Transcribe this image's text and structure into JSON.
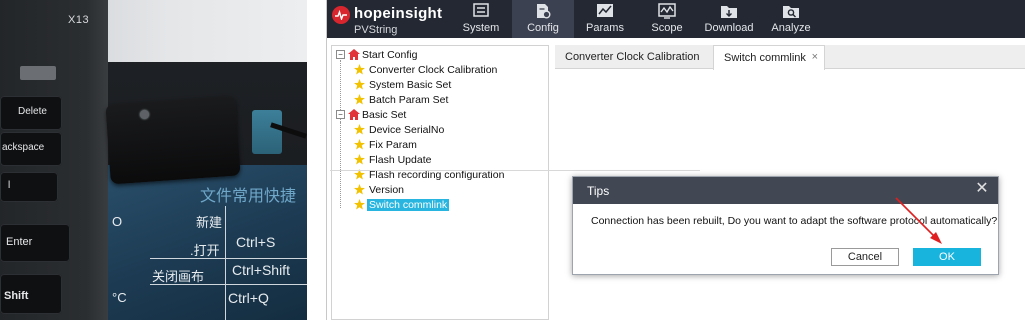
{
  "photo": {
    "laptop_model": "X13",
    "keys": [
      "Delete",
      "ackspace",
      "Enter",
      "Shift",
      "l"
    ],
    "mat_heading": "文件常用快捷",
    "mat_lines": [
      {
        "cn": "新建",
        "key": "Ctrl+S"
      },
      {
        "cn": ".打开",
        "key": "Ctrl+Shift"
      },
      {
        "cn": "关闭画布",
        "key": "Ctrl+Q"
      }
    ],
    "mat_glyphs": [
      "O",
      "°C"
    ]
  },
  "app": {
    "brand": {
      "name": "hopeinsight",
      "subtitle": "PVString",
      "logo_color": "#d9262e"
    },
    "nav": [
      {
        "label": "System",
        "icon": "system-icon"
      },
      {
        "label": "Config",
        "icon": "config-icon",
        "active": true
      },
      {
        "label": "Params",
        "icon": "params-icon"
      },
      {
        "label": "Scope",
        "icon": "scope-icon"
      },
      {
        "label": "Download",
        "icon": "download-icon"
      },
      {
        "label": "Analyze",
        "icon": "analyze-icon"
      }
    ],
    "tree": [
      {
        "label": "Start Config",
        "level": 0,
        "icon": "home-icon",
        "toggle": "-"
      },
      {
        "label": "Converter Clock Calibration",
        "level": 1,
        "icon": "star-icon"
      },
      {
        "label": "System Basic Set",
        "level": 1,
        "icon": "star-icon"
      },
      {
        "label": "Batch Param Set",
        "level": 1,
        "icon": "star-icon"
      },
      {
        "label": "Basic Set",
        "level": 0,
        "icon": "home-icon",
        "toggle": "-"
      },
      {
        "label": "Device SerialNo",
        "level": 1,
        "icon": "star-icon"
      },
      {
        "label": "Fix Param",
        "level": 1,
        "icon": "star-icon"
      },
      {
        "label": "Flash Update",
        "level": 1,
        "icon": "star-icon"
      },
      {
        "label": "Flash recording configuration",
        "level": 1,
        "icon": "star-icon"
      },
      {
        "label": "Version",
        "level": 1,
        "icon": "star-icon"
      },
      {
        "label": "Switch commlink",
        "level": 1,
        "icon": "star-icon",
        "selected": true
      }
    ],
    "tabs": [
      {
        "label": "Converter Clock Calibration",
        "active": false
      },
      {
        "label": "Switch commlink",
        "active": true,
        "close": "×"
      }
    ],
    "dialog": {
      "title": "Tips",
      "close": "✕",
      "message": "Connection has been rebuilt, Do you want to adapt the software protocol automatically?",
      "cancel_label": "Cancel",
      "ok_label": "OK"
    },
    "colors": {
      "topbar": "#232832",
      "accent": "#19b4de",
      "selected": "#28b5df",
      "star": "#f2c200",
      "home": "#e0333a",
      "annotation_arrow": "#e02020"
    }
  }
}
